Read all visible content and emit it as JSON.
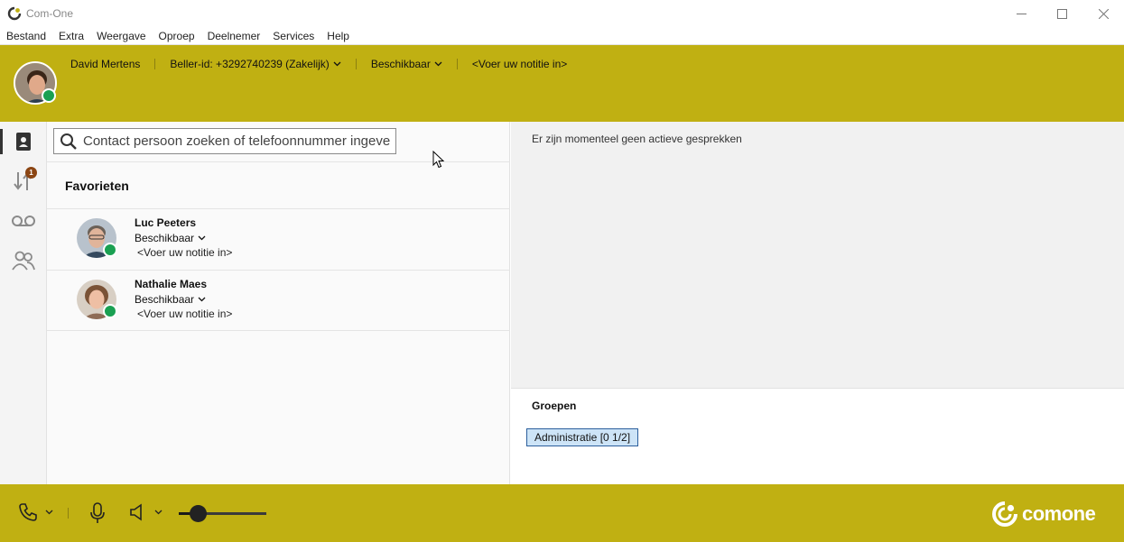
{
  "window": {
    "title": "Com-One",
    "controls": {
      "minimize": "minimize-icon",
      "maximize": "maximize-icon",
      "close": "close-icon"
    }
  },
  "menu": [
    "Bestand",
    "Extra",
    "Weergave",
    "Oproep",
    "Deelnemer",
    "Services",
    "Help"
  ],
  "header": {
    "user_name": "David Mertens",
    "caller_id": "Beller-id: +3292740239 (Zakelijk)",
    "status": "Beschikbaar",
    "note": "<Voer uw notitie in>"
  },
  "rail": {
    "badge_count": "1",
    "items": [
      "contacts-book-icon",
      "call-history-icon",
      "voicemail-icon",
      "groups-icon"
    ]
  },
  "search": {
    "placeholder": "Contact persoon zoeken of telefoonnummer ingeven"
  },
  "favorites": {
    "title": "Favorieten",
    "contacts": [
      {
        "name": "Luc Peeters",
        "status": "Beschikbaar",
        "note": "<Voer uw notitie in>"
      },
      {
        "name": "Nathalie Maes",
        "status": "Beschikbaar",
        "note": "<Voer uw notitie in>"
      }
    ]
  },
  "calls": {
    "empty_message": "Er zijn momenteel geen actieve gesprekken"
  },
  "groups": {
    "title": "Groepen",
    "items": [
      "Administratie [0 1/2]"
    ]
  },
  "footer": {
    "volume_level": 0.22,
    "brand": "comone"
  },
  "colors": {
    "accent": "#c0b012",
    "status_available": "#1aa052",
    "group_button_bg": "#cde4f7",
    "group_button_border": "#2b5e9c"
  }
}
